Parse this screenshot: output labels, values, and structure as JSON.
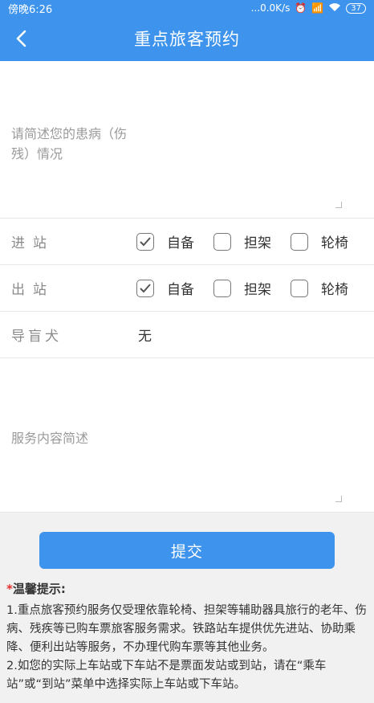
{
  "status_bar": {
    "time": "傍晚6:26",
    "network_speed": "...0.0K/s",
    "battery": "37"
  },
  "nav": {
    "title": "重点旅客预约"
  },
  "condition": {
    "placeholder": "请简述您的患病（伤残）情况"
  },
  "enter_station": {
    "label": "进站",
    "options": [
      {
        "label": "自备",
        "checked": true
      },
      {
        "label": "担架",
        "checked": false
      },
      {
        "label": "轮椅",
        "checked": false
      }
    ]
  },
  "exit_station": {
    "label": "出站",
    "options": [
      {
        "label": "自备",
        "checked": true
      },
      {
        "label": "担架",
        "checked": false
      },
      {
        "label": "轮椅",
        "checked": false
      }
    ]
  },
  "guide_dog": {
    "label": "导盲犬",
    "value": "无"
  },
  "service": {
    "placeholder": "服务内容简述"
  },
  "submit": {
    "label": "提交"
  },
  "tips": {
    "star": "*",
    "title": "温馨提示:",
    "items": [
      "1.重点旅客预约服务仅受理依靠轮椅、担架等辅助器具旅行的老年、伤病、残疾等已购车票旅客服务需求。铁路站车提供优先进站、协助乘降、便利出站等服务，不办理代购车票等其他业务。",
      "2.如您的实际上车站或下车站不是票面发站或到站，请在“乘车站”或“到站”菜单中选择实际上车站或下车站。"
    ]
  },
  "colors": {
    "primary": "#3e94ec",
    "background": "#f1f1f1",
    "warning_star": "#e23030"
  }
}
